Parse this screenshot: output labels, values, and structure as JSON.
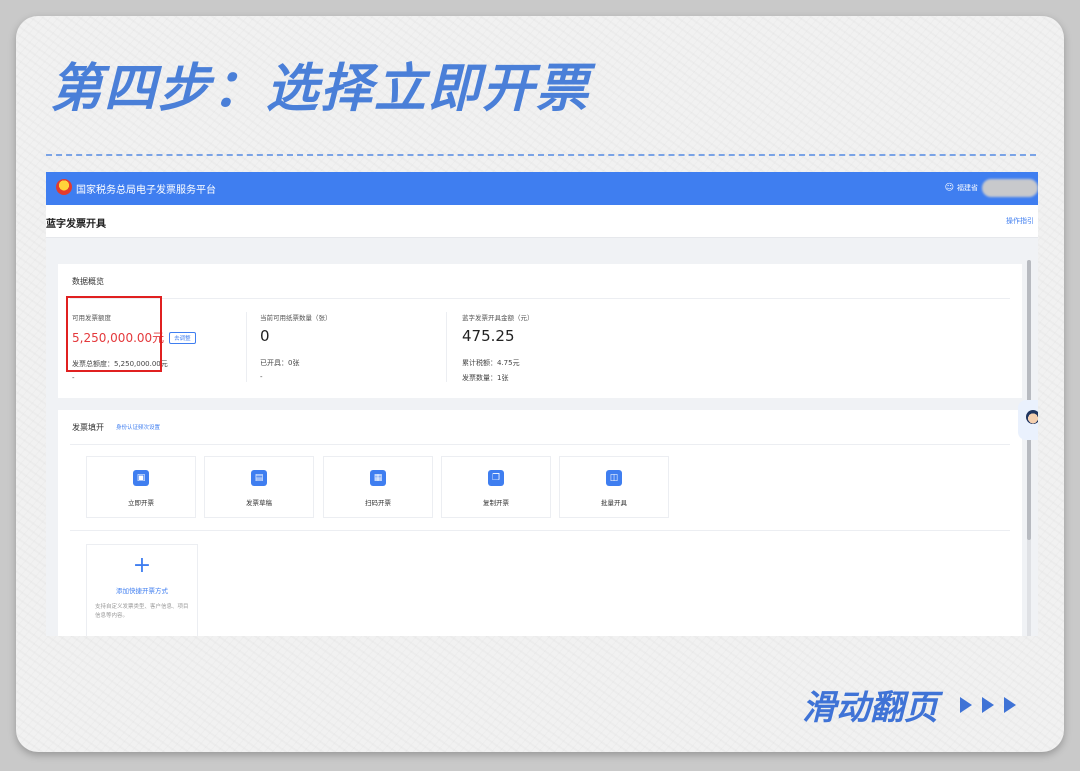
{
  "step_title": "第四步：选择立即开票",
  "platform": {
    "name": "国家税务总局电子发票服务平台",
    "user_label": "福建省"
  },
  "page": {
    "title": "蓝字发票开具",
    "guide_link": "操作指引"
  },
  "overview": {
    "title": "数据概览",
    "columns": [
      {
        "label": "可用发票额度",
        "value": "5,250,000.00元",
        "button": "去调整",
        "sub1": "发票总额度：5,250,000.00元",
        "sub2": "-"
      },
      {
        "label": "当前可用纸票数量（张）",
        "value": "0",
        "sub1": "已开具：0张",
        "sub2": "-"
      },
      {
        "label": "蓝字发票开具金额（元）",
        "value": "475.25",
        "sub1": "累计税额：4.75元",
        "sub2": "发票数量：1张"
      }
    ]
  },
  "issue": {
    "title": "发票填开",
    "link": "身份认证频次设置",
    "tiles": [
      {
        "label": "立即开票",
        "icon": "invoice-icon",
        "selected": true
      },
      {
        "label": "发票草稿",
        "icon": "draft-icon"
      },
      {
        "label": "扫码开票",
        "icon": "qrcode-icon"
      },
      {
        "label": "复制开票",
        "icon": "copy-icon"
      },
      {
        "label": "批量开具",
        "icon": "batch-icon"
      }
    ],
    "add": {
      "plus": "+",
      "label": "添加快捷开票方式",
      "desc": "支持自定义发票类型、客户信息、项目信息等内容。"
    }
  },
  "footer": {
    "swipe_text": "滑动翻页"
  },
  "colors": {
    "accent": "#3f7ef0",
    "title_blue": "#4a7fd8",
    "highlight_red": "#e02020",
    "amount_red": "#e4393c"
  }
}
